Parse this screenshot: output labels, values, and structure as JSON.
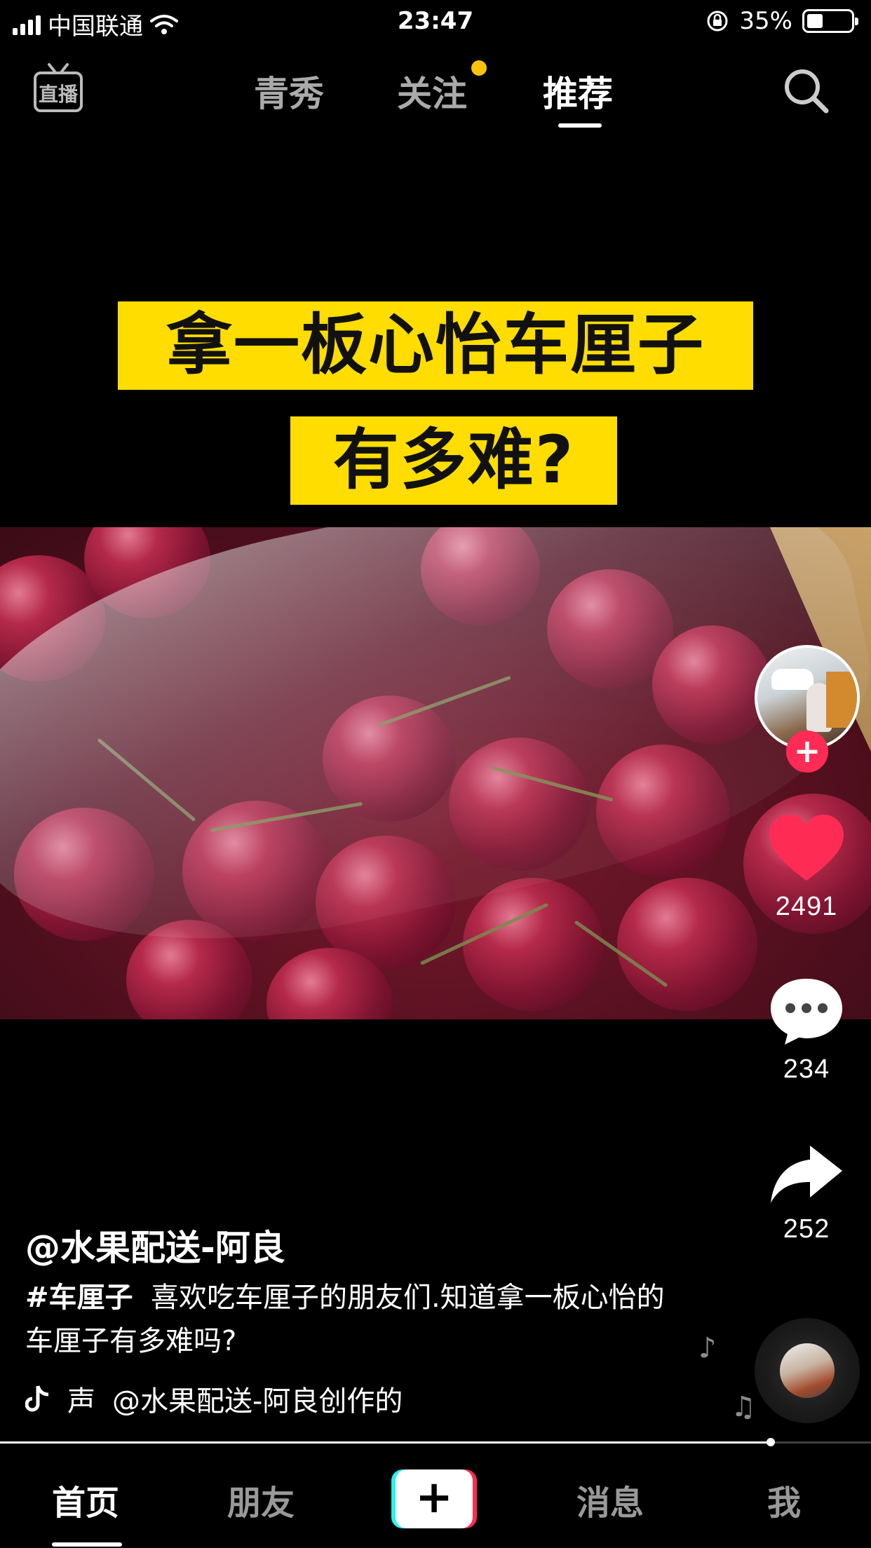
{
  "status_bar": {
    "carrier": "中国联通",
    "time": "23:47",
    "battery": "35%",
    "battery_level": 0.35
  },
  "top_nav": {
    "live_icon_label": "直播",
    "tabs": [
      {
        "label": "青秀",
        "active": false
      },
      {
        "label": "关注",
        "active": false,
        "has_dot": true
      },
      {
        "label": "推荐",
        "active": true
      }
    ]
  },
  "video": {
    "caption_line1": "拿一板心怡车厘子",
    "caption_line2": "有多难?"
  },
  "rail": {
    "like_count": "2491",
    "comment_count": "234",
    "share_count": "252"
  },
  "post": {
    "author": "@水果配送-阿良",
    "hashtag": "#车厘子",
    "description": "喜欢吃车厘子的朋友们.知道拿一板心怡的车厘子有多难吗?",
    "music_prefix": "声",
    "music_label": "@水果配送-阿良创作的"
  },
  "progress": {
    "value": 0.885
  },
  "bottom_nav": {
    "items": [
      {
        "label": "首页",
        "active": true
      },
      {
        "label": "朋友",
        "active": false
      },
      {
        "label": "+",
        "active": false
      },
      {
        "label": "消息",
        "active": false
      },
      {
        "label": "我",
        "active": false
      }
    ]
  },
  "colors": {
    "accent": "#fe2c55",
    "caption_bg": "#ffdd00",
    "follow_dot": "#f9c20c",
    "teal": "#25f4ee"
  }
}
